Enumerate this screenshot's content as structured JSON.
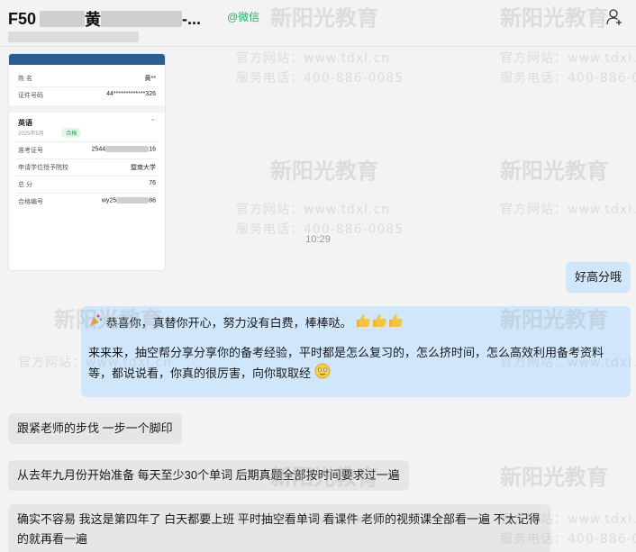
{
  "header": {
    "title_prefix": "F50",
    "title_mid": "黄",
    "title_suffix": "-...",
    "channel_tag": "@微信"
  },
  "score_card": {
    "name_label": "姓    名",
    "name_value": "黄**",
    "id_label": "证件号码",
    "id_value": "44*************326",
    "subject": "英语",
    "date": "2025年5月",
    "status": "合格",
    "exam_no_label": "准考证号",
    "exam_no_value_start": "2544",
    "exam_no_value_end": "16",
    "school_label": "申请学位授予院校",
    "school_value": "暨南大学",
    "score_label": "总    分",
    "score_value": "76",
    "cert_label": "合格编号",
    "cert_value_start": "wy25",
    "cert_value_end": "86"
  },
  "time_divider": "10:29",
  "messages": {
    "me_reply": "好高分哦",
    "quote_line1": "恭喜你，真替你开心，努力没有白费，棒棒哒。",
    "quote_line2": "来来来，抽空帮分享分享你的备考经验，平时都是怎么复习的，怎么挤时间，怎么高效利用备考资料等，都说说看，你真的很厉害，向你取取经",
    "msg1": "跟紧老师的步伐 一步一个脚印",
    "msg2": "从去年九月份开始准备 每天至少30个单词 后期真题全部按时间要求过一遍",
    "msg3": "确实不容易 我这是第四年了 白天都要上班 平时抽空看单词 看课件 老师的视频课全部看一遍 不太记得的就再看一遍"
  },
  "watermark": {
    "brand": "新阳光教育",
    "site": "官方网站：www.tdxl.cn",
    "phone": "服务电话：400-886-0085"
  },
  "icons": {
    "add_user": "add-user-icon",
    "thumbs_up": "thumbs-up-icon",
    "party": "party-popper-icon",
    "smile": "smile-icon"
  }
}
